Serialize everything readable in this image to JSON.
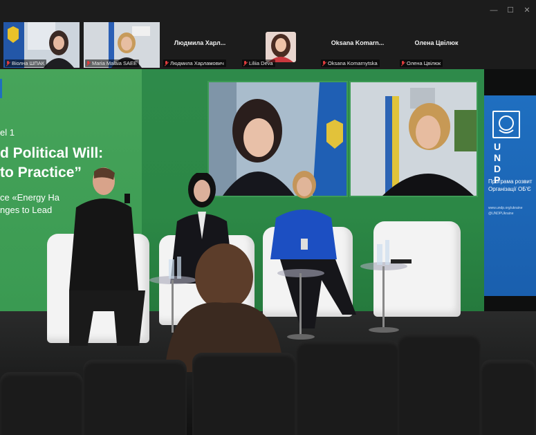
{
  "window": {
    "controls": {
      "minimize": "—",
      "maximize": "☐",
      "close": "✕"
    }
  },
  "participants": [
    {
      "id": "p1",
      "label": "Віолна ШПАК",
      "muted": true,
      "video": true
    },
    {
      "id": "p2",
      "label": "Maria Malaia SAEE",
      "muted": true,
      "video": true
    },
    {
      "id": "p3",
      "label": "Людмила Харламович",
      "name_display": "Людмила  Харл...",
      "muted": true,
      "video": false
    },
    {
      "id": "p4",
      "label": "Liliia Deva",
      "muted": true,
      "video": true
    },
    {
      "id": "p5",
      "label": "Oksana Komarnytska",
      "name_display": "Oksana  Komarn...",
      "muted": true,
      "video": false
    },
    {
      "id": "p6",
      "label": "Олена Цвілюк",
      "name_display": "Олена Цвілюк",
      "muted": true,
      "video": false
    }
  ],
  "stage": {
    "wall_text": {
      "line1": "el 1",
      "line2": "d Political Will:",
      "line3": "to Practice”",
      "line4": "ce «Energy Ha",
      "line5": "nges to Lead"
    },
    "banner": {
      "logo": "U N D P",
      "line1": "Програма розвит",
      "line2": "Організації ОБ'Є",
      "small1": "www.undp.org/ukraine",
      "small2": "@UNDPUkraine"
    }
  },
  "colors": {
    "wall_green": "#2e8a4a",
    "banner_blue": "#1f6fc0",
    "muted_red": "#e03c3c"
  }
}
